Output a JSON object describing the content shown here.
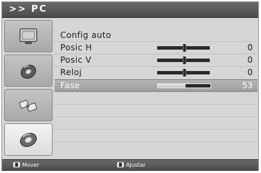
{
  "header": {
    "title": ">> PC"
  },
  "sidebar": {
    "tabs": [
      {
        "icon": "monitor-icon",
        "active": false
      },
      {
        "icon": "sound-disc-icon",
        "active": false
      },
      {
        "icon": "satellite-icon",
        "active": false
      },
      {
        "icon": "settings-disc-icon",
        "active": true
      }
    ]
  },
  "menu": {
    "items": [
      {
        "label": "Config auto",
        "value": ""
      },
      {
        "label": "Posic H",
        "value": "0",
        "level": 0.5
      },
      {
        "label": "Posic V",
        "value": "0",
        "level": 0.5
      },
      {
        "label": "Reloj",
        "value": "0",
        "level": 0.5
      },
      {
        "label": "Fase",
        "value": "53",
        "level": 0.53,
        "selected": true
      }
    ]
  },
  "footer": {
    "hints": [
      {
        "icon": "up-down-key-icon",
        "label": "Mover"
      },
      {
        "icon": "left-right-key-icon",
        "label": "Ajustar"
      }
    ]
  },
  "colors": {
    "panel": "#d6d6d6",
    "bar": "#4a4a4a",
    "selected": "#a8a8a8"
  }
}
